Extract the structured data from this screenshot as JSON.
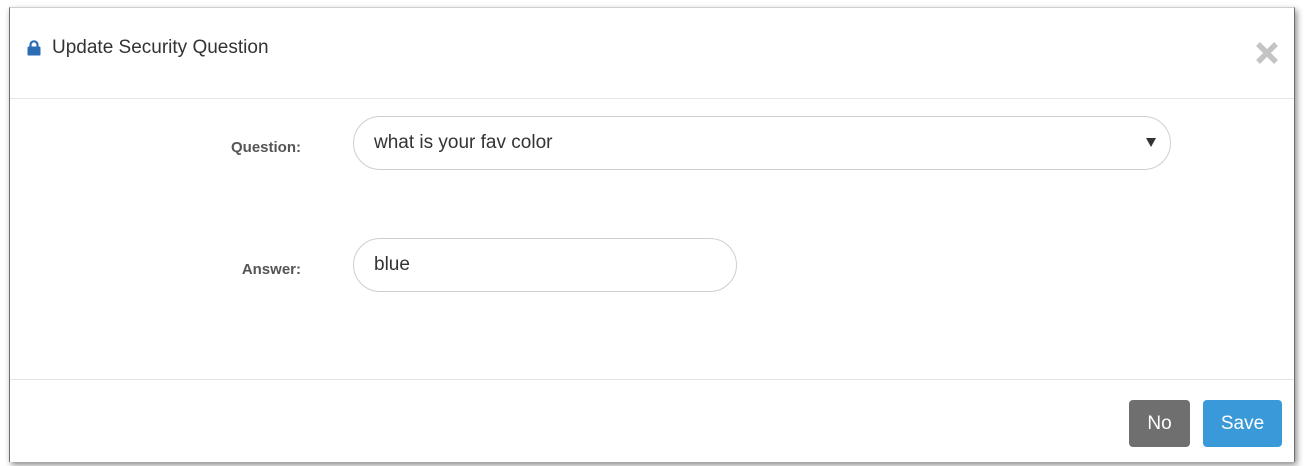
{
  "dialog": {
    "title": "Update Security Question",
    "icons": {
      "title_icon": "lock-icon",
      "close_icon": "close-icon"
    }
  },
  "form": {
    "question": {
      "label": "Question:",
      "selected_value": "what is your fav color"
    },
    "answer": {
      "label": "Answer:",
      "value": "blue"
    }
  },
  "footer": {
    "no_label": "No",
    "save_label": "Save"
  },
  "colors": {
    "no_button": "#6f6f6f",
    "save_button": "#3a9ad9",
    "lock_icon": "#2a6db5",
    "close_icon": "#c4c4c4"
  }
}
